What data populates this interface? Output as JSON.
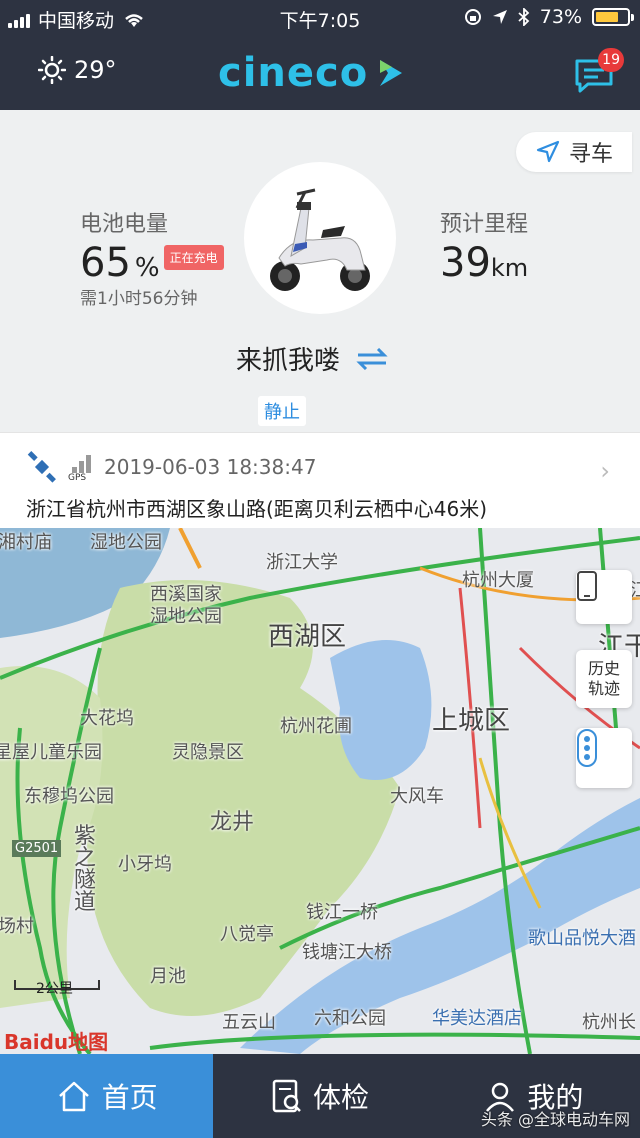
{
  "status_bar": {
    "carrier": "中国移动",
    "time": "下午7:05",
    "battery_percent": "73%",
    "battery_level": 0.73
  },
  "header": {
    "temperature": "29°",
    "logo": "cineco",
    "message_badge": "19"
  },
  "vehicle": {
    "find_car_label": "寻车",
    "battery_label": "电池电量",
    "battery_value": "65",
    "battery_unit": "%",
    "charging_badge": "正在充电",
    "charge_time": "需1小时56分钟",
    "range_label": "预计里程",
    "range_value": "39",
    "range_unit": "km",
    "nickname": "来抓我喽",
    "state": "静止"
  },
  "location": {
    "gps_label": "GPS",
    "timestamp": "2019-06-03 18:38:47",
    "address": "浙江省杭州市西湖区象山路(距离贝利云栖中心46米)"
  },
  "map": {
    "labels": {
      "xixi": "西溪国家",
      "xixi2": "湿地公园",
      "zju": "浙江大学",
      "hzds": "杭州大厦",
      "xihu": "西湖区",
      "shangcheng": "上城区",
      "dahuawu": "大花坞",
      "children_park": "星屋儿童乐园",
      "lingyin": "灵隐景区",
      "hzhp": "杭州花圃",
      "dafengche": "大风车",
      "dongmu": "东穆坞公园",
      "longjing": "龙井",
      "g2501": "G2501",
      "zizhi1": "紫",
      "zizhi2": "之",
      "zizhi3": "隧",
      "zizhi4": "道",
      "xiaoyawu": "小牙坞",
      "qjyq": "钱江一桥",
      "qtjdq": "钱塘江大桥",
      "bajueting": "八觉亭",
      "yuechi": "月池",
      "wuyunshan": "五云山",
      "liuhe": "六和公园",
      "huameida": "华美达酒店",
      "gesp": "歌山品悦大酒",
      "hzc": "杭州长",
      "changchang": "场村",
      "zhijiang": "浙江",
      "jianggan": "江干",
      "shidi": "湿地公园",
      "shicun": "湘村",
      "top_left": "湘村庙"
    },
    "history_button": "历史轨迹",
    "history_line1": "历史",
    "history_line2": "轨迹",
    "scale": "2公里",
    "brand": "Baidu地图"
  },
  "tabs": [
    {
      "label": "首页",
      "icon": "home-icon",
      "active": true
    },
    {
      "label": "体检",
      "icon": "checkup-icon",
      "active": false
    },
    {
      "label": "我的",
      "icon": "profile-icon",
      "active": false
    }
  ],
  "watermark": "头条 @全球电动车网",
  "colors": {
    "header_bg": "#2d3341",
    "accent_blue": "#3a8fd9",
    "logo": "#2ec0e8",
    "badge_red": "#e83a3a"
  }
}
